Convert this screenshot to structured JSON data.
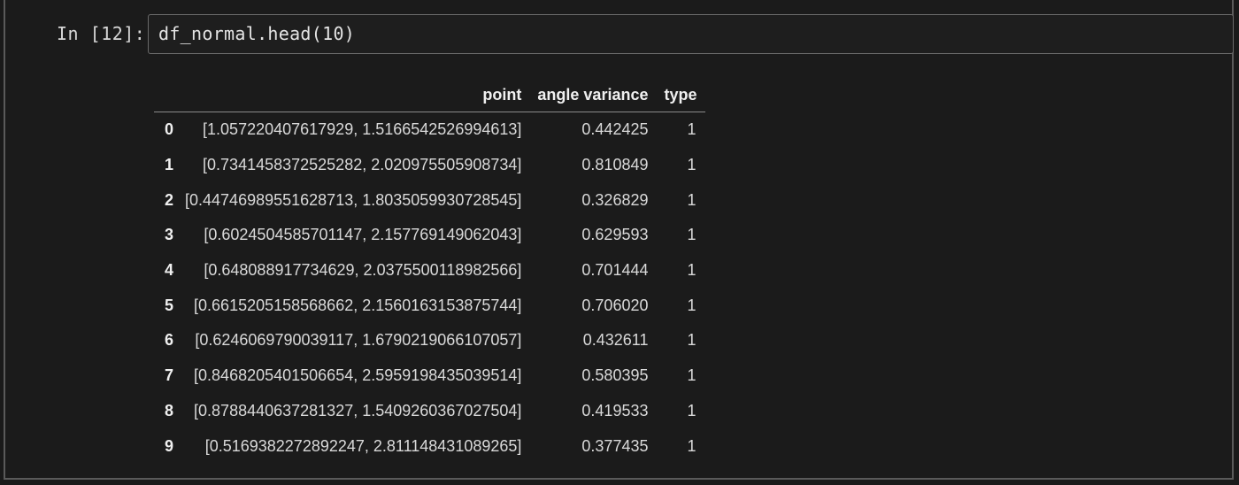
{
  "cell": {
    "prompt": "In [12]:",
    "code": "df_normal.head(10)"
  },
  "table": {
    "columns": [
      "point",
      "angle variance",
      "type"
    ],
    "rows": [
      {
        "index": "0",
        "point": "[1.057220407617929, 1.5166542526994613]",
        "angle_variance": "0.442425",
        "type": "1"
      },
      {
        "index": "1",
        "point": "[0.7341458372525282, 2.020975505908734]",
        "angle_variance": "0.810849",
        "type": "1"
      },
      {
        "index": "2",
        "point": "[0.44746989551628713, 1.8035059930728545]",
        "angle_variance": "0.326829",
        "type": "1"
      },
      {
        "index": "3",
        "point": "[0.6024504585701147, 2.157769149062043]",
        "angle_variance": "0.629593",
        "type": "1"
      },
      {
        "index": "4",
        "point": "[0.648088917734629, 2.0375500118982566]",
        "angle_variance": "0.701444",
        "type": "1"
      },
      {
        "index": "5",
        "point": "[0.6615205158568662, 2.1560163153875744]",
        "angle_variance": "0.706020",
        "type": "1"
      },
      {
        "index": "6",
        "point": "[0.6246069790039117, 1.6790219066107057]",
        "angle_variance": "0.432611",
        "type": "1"
      },
      {
        "index": "7",
        "point": "[0.8468205401506654, 2.5959198435039514]",
        "angle_variance": "0.580395",
        "type": "1"
      },
      {
        "index": "8",
        "point": "[0.8788440637281327, 1.5409260367027504]",
        "angle_variance": "0.419533",
        "type": "1"
      },
      {
        "index": "9",
        "point": "[0.5169382272892247, 2.811148431089265]",
        "angle_variance": "0.377435",
        "type": "1"
      }
    ]
  }
}
